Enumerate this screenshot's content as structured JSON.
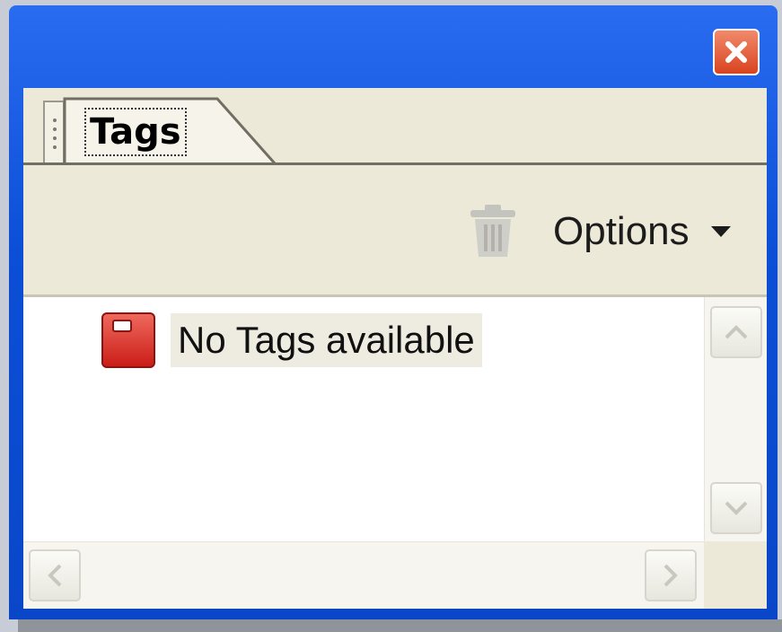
{
  "panel": {
    "tab_label": "Tags",
    "toolbar": {
      "trash_icon": "trash-icon",
      "options_label": "Options",
      "options_arrow_icon": "dropdown-arrow-icon"
    },
    "tree": {
      "items": [
        {
          "label": "No Tags available",
          "icon": "tag-icon"
        }
      ]
    },
    "icons": {
      "close": "close-icon",
      "scroll_up": "scroll-up-arrow-icon",
      "scroll_down": "scroll-down-arrow-icon",
      "scroll_left": "scroll-left-arrow-icon",
      "scroll_right": "scroll-right-arrow-icon"
    }
  },
  "colors": {
    "titlebar_blue": "#0b4fd6",
    "close_red": "#d9431f",
    "panel_beige": "#ece9d8",
    "content_white": "#ffffff"
  }
}
